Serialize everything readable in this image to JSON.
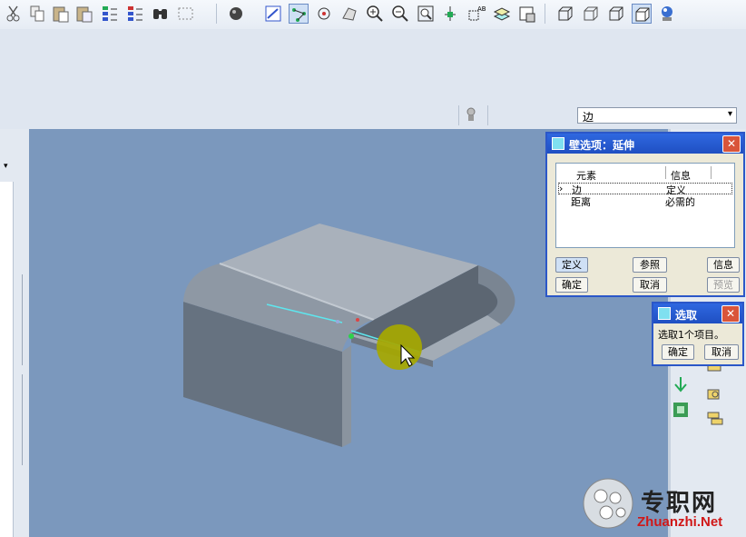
{
  "toolbar": {
    "icons": [
      "cut-icon",
      "copy-icon",
      "paste-icon",
      "paste-special-icon",
      "regenerate-icon",
      "regen-manager-icon",
      "find-icon",
      "select-box-icon",
      "shade-sphere-icon",
      "sketch-icon",
      "datum-icon",
      "spin-center-icon",
      "orient-icon",
      "zoom-in-icon",
      "zoom-out-icon",
      "refit-icon",
      "datum-plane-display-icon",
      "annotation-icon",
      "layers-icon",
      "saved-views-icon",
      "wireframe-icon",
      "hidden-line-icon",
      "no-hidden-icon",
      "shading-icon",
      "appearance-icon"
    ]
  },
  "filter": {
    "selected": "边",
    "arrow": "▾"
  },
  "wall_dialog": {
    "title": "壁选项：延伸",
    "close": "✕",
    "columns": [
      "元素",
      "信息"
    ],
    "rows": [
      {
        "marker": "›",
        "element": "边",
        "info": "定义"
      },
      {
        "marker": "",
        "element": "距离",
        "info": "必需的"
      }
    ],
    "buttons": {
      "define": "定义",
      "reference": "参照",
      "info": "信息",
      "ok": "确定",
      "cancel": "取消",
      "preview": "预览"
    }
  },
  "select_dialog": {
    "title": "选取",
    "close": "✕",
    "message": "选取1个项目。",
    "ok": "确定",
    "cancel": "取消"
  },
  "watermark": {
    "cn": "专职网",
    "en": "Zhuanzhi.Net"
  },
  "colors": {
    "viewport_bg": "#7b98bd",
    "dialog_title": "#2f68e0",
    "close_button": "#d9553a",
    "part_top": "#a9b1bb",
    "highlight": "#a6a800"
  }
}
